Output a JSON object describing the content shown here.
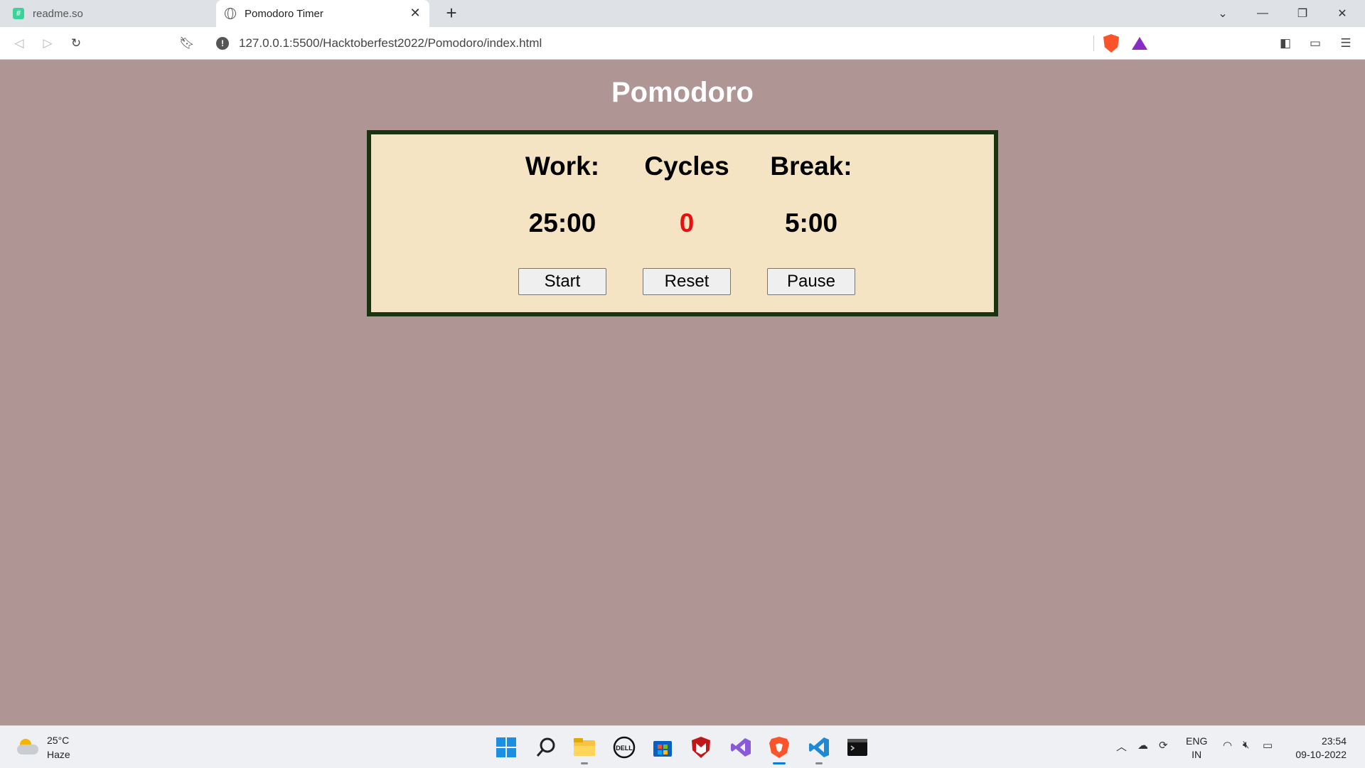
{
  "browser": {
    "tabs": [
      {
        "label": "readme.so",
        "icon": "readme-favicon",
        "active": false
      },
      {
        "label": "Pomodoro Timer",
        "icon": "globe-icon",
        "active": true
      }
    ],
    "new_tab_label": "+",
    "url": "127.0.0.1:5500/Hacktoberfest2022/Pomodoro/index.html"
  },
  "page": {
    "title": "Pomodoro",
    "columns": [
      {
        "label": "Work:",
        "value": "25:00",
        "button": "Start"
      },
      {
        "label": "Cycles",
        "value": "0",
        "button": "Reset"
      },
      {
        "label": "Break:",
        "value": "5:00",
        "button": "Pause"
      }
    ],
    "colors": {
      "background": "#af9594",
      "panel": "#f5e4c3",
      "panel_border": "#1a3311",
      "cycles_value": "#e90f0f"
    }
  },
  "taskbar": {
    "weather": {
      "temp": "25°C",
      "desc": "Haze"
    },
    "apps": [
      "start-icon",
      "search-icon",
      "file-explorer-icon",
      "dell-icon",
      "store-icon",
      "mcafee-icon",
      "visual-studio-icon",
      "brave-icon",
      "vscode-icon",
      "terminal-icon"
    ],
    "language": {
      "line1": "ENG",
      "line2": "IN"
    },
    "clock": {
      "time": "23:54",
      "date": "09-10-2022"
    }
  }
}
